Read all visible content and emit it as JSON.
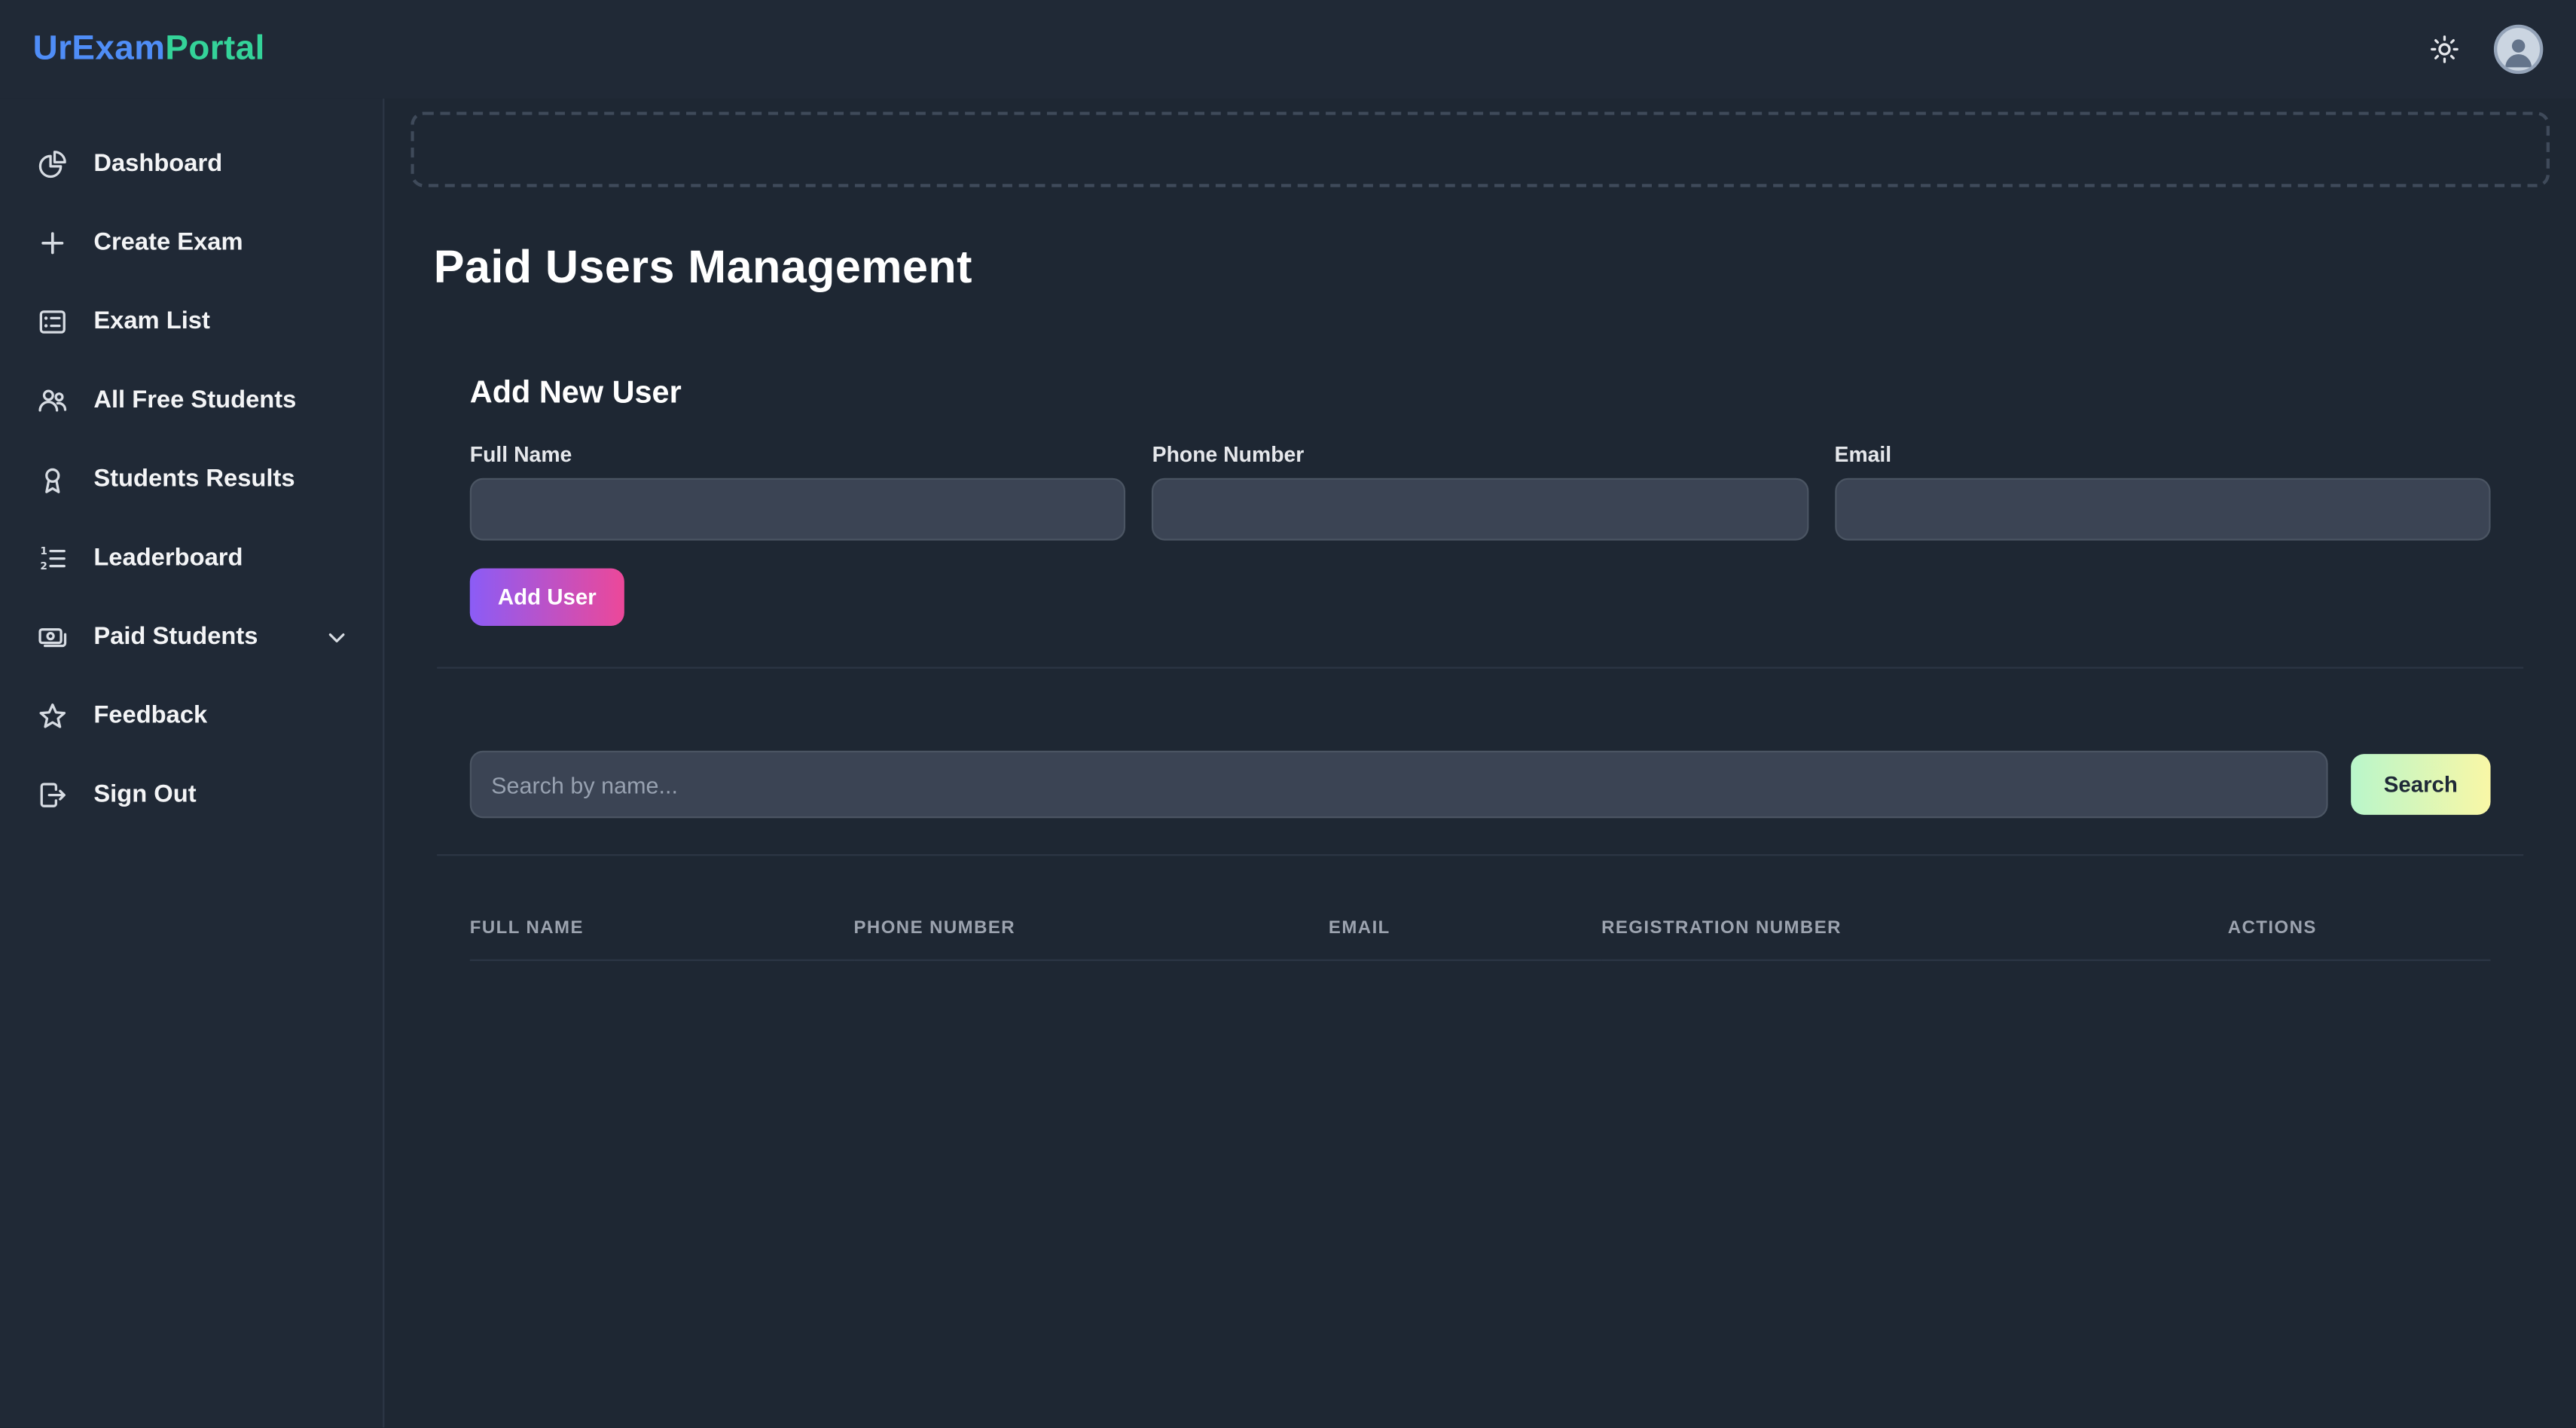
{
  "app": {
    "logo": {
      "part1": "UrExam",
      "part2": "Portal"
    },
    "header_icons": [
      "sun-icon",
      "user-avatar-icon"
    ]
  },
  "colors": {
    "background": "#1e2733",
    "panel": "#202936",
    "logo_primary": "#4f8df7",
    "logo_secondary": "#34d399",
    "input_background": "#3b4454",
    "add_user_gradient_start": "#8b5cf6",
    "add_user_gradient_end": "#ec4899",
    "search_gradient_start": "#b9f6ca",
    "search_gradient_end": "#f9f7a6"
  },
  "sidebar": {
    "items": [
      {
        "label": "Dashboard",
        "icon": "pie-chart-icon"
      },
      {
        "label": "Create Exam",
        "icon": "plus-icon"
      },
      {
        "label": "Exam List",
        "icon": "list-card-icon"
      },
      {
        "label": "All Free Students",
        "icon": "users-icon"
      },
      {
        "label": "Students Results",
        "icon": "medal-icon"
      },
      {
        "label": "Leaderboard",
        "icon": "numbered-list-icon"
      },
      {
        "label": "Paid Students",
        "icon": "banknotes-icon",
        "has_chevron": true
      },
      {
        "label": "Feedback",
        "icon": "star-icon"
      },
      {
        "label": "Sign Out",
        "icon": "sign-out-icon"
      }
    ]
  },
  "main": {
    "page_title": "Paid Users Management",
    "add_user": {
      "title": "Add New User",
      "fields": [
        {
          "label": "Full Name",
          "value": ""
        },
        {
          "label": "Phone Number",
          "value": ""
        },
        {
          "label": "Email",
          "value": ""
        }
      ],
      "submit_label": "Add User"
    },
    "search": {
      "placeholder": "Search by name...",
      "button_label": "Search"
    },
    "table": {
      "headers": [
        "FULL NAME",
        "PHONE NUMBER",
        "EMAIL",
        "REGISTRATION NUMBER",
        "ACTIONS"
      ],
      "rows": []
    }
  }
}
